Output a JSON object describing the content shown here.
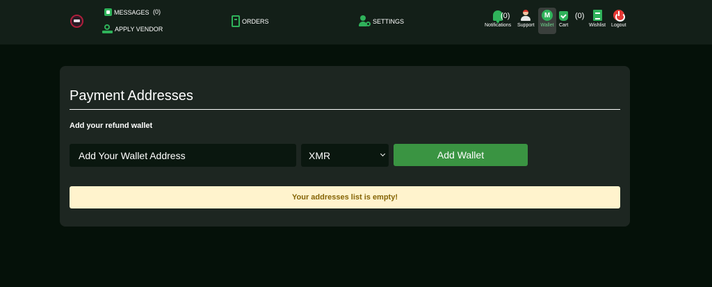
{
  "header": {
    "messages_label": "MESSAGES",
    "messages_count": "(0)",
    "apply_vendor_label": "APPLY VENDOR",
    "orders_label": "ORDERS",
    "settings_label": "SETTINGS",
    "notifications_label": "Notifications",
    "notifications_count": "(0)",
    "support_label": "Support",
    "wallet_label": "Wallet",
    "wallet_icon_glyph": "M",
    "cart_label": "Cart",
    "cart_count": "(0)",
    "wishlist_label": "Wishlist",
    "logout_label": "Logout"
  },
  "icons": {
    "logo": "site-logo",
    "messages": "message-icon",
    "apply_vendor": "vendor-icon",
    "orders": "clipboard-icon",
    "settings": "user-gear-icon",
    "notifications": "bell-icon",
    "support": "support-agent-icon",
    "wallet": "monero-icon",
    "cart": "cart-check-icon",
    "wishlist": "list-icon",
    "logout": "power-icon"
  },
  "main": {
    "title": "Payment Addresses",
    "subtitle": "Add your refund wallet",
    "wallet_input_placeholder": "Add Your Wallet Address",
    "wallet_input_value": "",
    "coin_selected": "XMR",
    "add_button_label": "Add Wallet",
    "empty_message": "Your addresses list is empty!"
  },
  "colors": {
    "accent_green": "#2fb25a",
    "button_green": "#3a9442",
    "logout_red": "#e53935",
    "alert_bg": "#fff3cd",
    "alert_text": "#856404"
  }
}
